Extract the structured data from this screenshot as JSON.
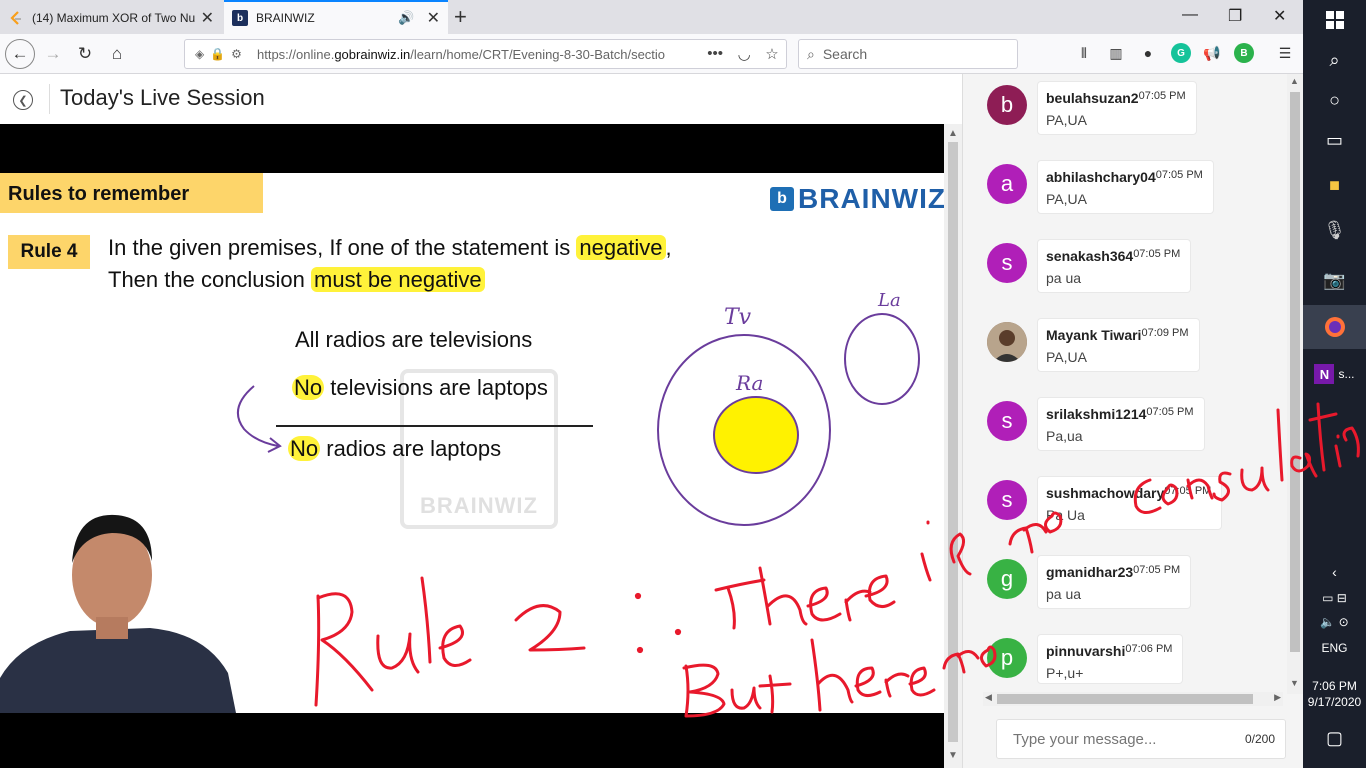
{
  "browser": {
    "tabs": [
      {
        "title": "(14) Maximum XOR of Two Nu",
        "favicon": "leetcode-icon"
      },
      {
        "title": "BRAINWIZ",
        "favicon": "brainwiz-icon",
        "audio": "speaker-icon"
      }
    ],
    "url_prefix": "https://online.",
    "url_domain": "gobrainwiz.in",
    "url_path": "/learn/home/CRT/Evening-8-30-Batch/sectio",
    "search_placeholder": "Search"
  },
  "page": {
    "title": "Today's Live Session"
  },
  "slide": {
    "banner": "Rules to remember",
    "logo_text": "BRAINWIZ",
    "rule_badge": "Rule 4",
    "rule_line1_a": "In the given premises, If one of the statement is ",
    "rule_line1_hl": "negative",
    "rule_line1_b": ",",
    "rule_line2_a": "Then the conclusion ",
    "rule_line2_hl": "must be negative",
    "premise1": "All radios are televisions",
    "premise2_hl": "No",
    "premise2_rest": " televisions are laptops",
    "conclusion_hl": "No",
    "conclusion_rest": " radios are laptops",
    "watermark": "BRAINWIZ",
    "diagram_labels": {
      "tv": "Tv",
      "ra": "Ra",
      "la": "La"
    }
  },
  "annotation_text": [
    "Rule 2 : there is no consulation",
    "But here no"
  ],
  "chat": {
    "messages": [
      {
        "user": "beulahsuzan2",
        "time": "07:05 PM",
        "text": "PA,UA",
        "initial": "b",
        "color": "#8e1d55"
      },
      {
        "user": "abhilashchary04",
        "time": "07:05 PM",
        "text": "PA,UA",
        "initial": "a",
        "color": "#b01fb8"
      },
      {
        "user": "senakash364",
        "time": "07:05 PM",
        "text": "pa ua",
        "initial": "s",
        "color": "#b01fb8"
      },
      {
        "user": "Mayank Tiwari",
        "time": "07:09 PM",
        "text": "PA,UA",
        "initial": "",
        "color": "#7a5c48"
      },
      {
        "user": "srilakshmi1214",
        "time": "07:05 PM",
        "text": "Pa,ua",
        "initial": "s",
        "color": "#b01fb8"
      },
      {
        "user": "sushmachowdary",
        "time": "07:05 PM",
        "text": "Pa Ua",
        "initial": "s",
        "color": "#b01fb8"
      },
      {
        "user": "gmanidhar23",
        "time": "07:05 PM",
        "text": "pa ua",
        "initial": "g",
        "color": "#38b244"
      },
      {
        "user": "pinnuvarshi",
        "time": "07:06 PM",
        "text": "P+,u+",
        "initial": "p",
        "color": "#38b244"
      }
    ],
    "input_placeholder": "Type your message...",
    "char_count": "0/200"
  },
  "taskbar": {
    "language": "ENG",
    "time": "7:06 PM",
    "date": "9/17/2020",
    "onenote_label": "s..."
  }
}
